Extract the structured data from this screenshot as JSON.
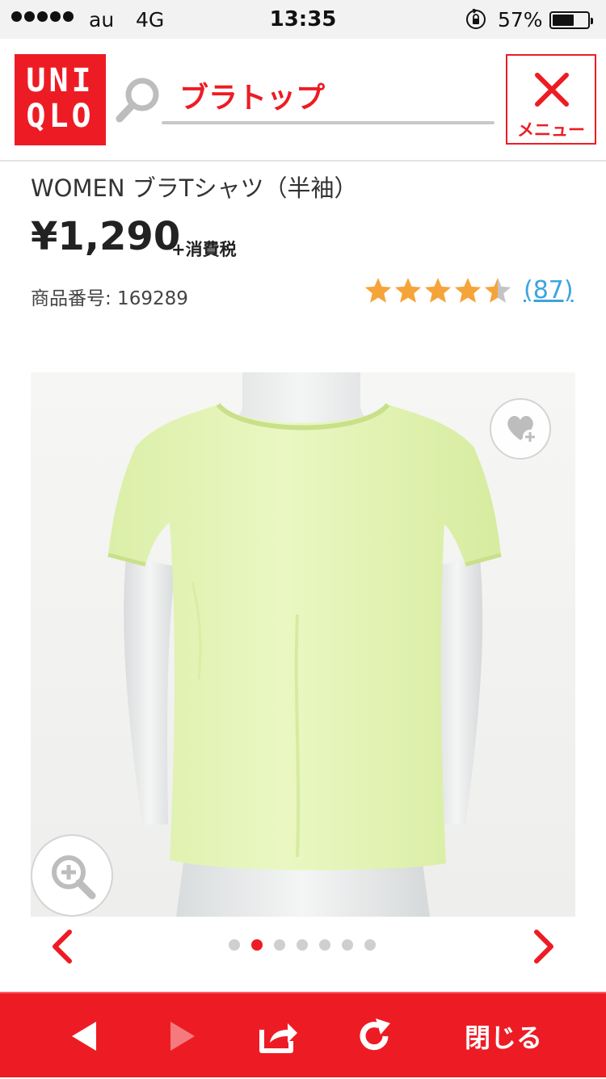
{
  "status_bar": {
    "carrier": "au",
    "network": "4G",
    "time": "13:35",
    "battery_percent": "57%",
    "battery_level": 0.57
  },
  "header": {
    "logo_line1": "UNI",
    "logo_line2": "QLO",
    "search_query": "ブラトップ",
    "menu_label": "メニュー",
    "brand_color": "#ed1c24"
  },
  "product": {
    "title": "WOMEN ブラTシャツ（半袖）",
    "price": "¥1,290",
    "tax_note": "+消費税",
    "product_number": "商品番号: 169289",
    "rating": 4.5,
    "rating_max": 5,
    "review_count": "(87)",
    "star_color": "#f5a43a",
    "link_color": "#3ba4e0"
  },
  "gallery": {
    "image_count": 7,
    "active_index": 1,
    "icons": [
      "wishlist-heart-plus-icon",
      "zoom-magnifier-icon",
      "chevron-left-icon",
      "chevron-right-icon"
    ]
  },
  "toolbar": {
    "close_label": "閉じる",
    "icons": [
      "back-triangle-icon",
      "forward-triangle-icon",
      "share-icon",
      "reload-icon"
    ]
  }
}
